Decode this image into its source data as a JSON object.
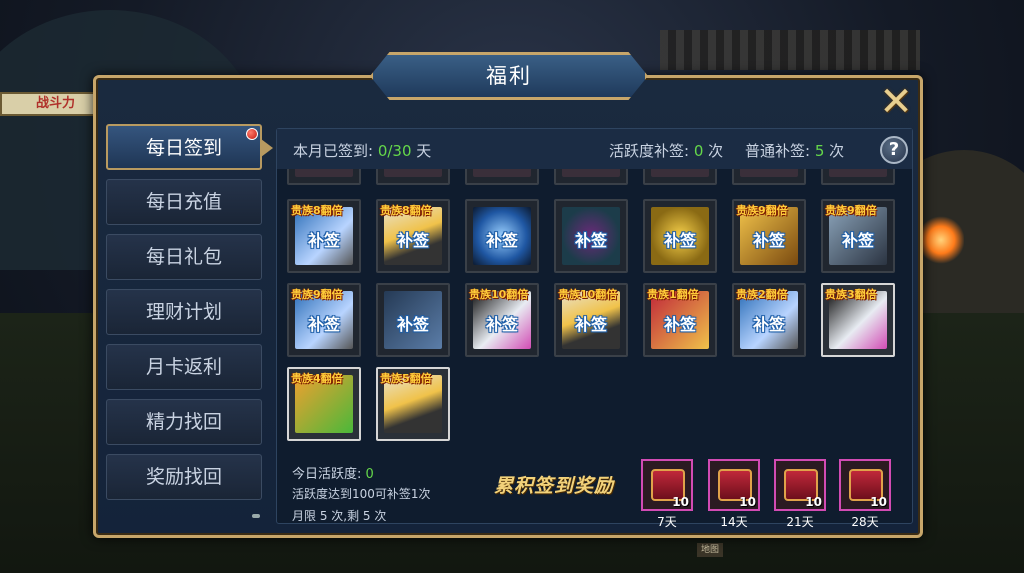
{
  "scene": {
    "sign_text": "战斗力",
    "bottom_label": "地图"
  },
  "window": {
    "title": "福利",
    "close_icon": "close-x-icon",
    "help_icon": "help-icon"
  },
  "sidebar": {
    "items": [
      {
        "label": "每日签到",
        "active": true,
        "badge": true
      },
      {
        "label": "每日充值"
      },
      {
        "label": "每日礼包"
      },
      {
        "label": "理财计划"
      },
      {
        "label": "月卡返利"
      },
      {
        "label": "精力找回"
      },
      {
        "label": "奖励找回"
      }
    ]
  },
  "info": {
    "signed_label": "本月已签到: ",
    "signed_value": "0/30",
    "signed_unit": " 天",
    "active_label": "活跃度补签: ",
    "active_value": "0",
    "active_unit": " 次",
    "normal_label": "普通补签: ",
    "normal_value": "5",
    "normal_unit": " 次"
  },
  "grid": {
    "makeup_label": "补签",
    "row_top_partial": 7,
    "tiles": [
      {
        "vip": "贵族8翻倍",
        "bq": true,
        "icon": "scroll-icon"
      },
      {
        "vip": "贵族8翻倍",
        "bq": true,
        "icon": "energy-plus10-icon"
      },
      {
        "vip": "",
        "bq": true,
        "icon": "planet-orb-icon"
      },
      {
        "vip": "",
        "bq": true,
        "icon": "demon-mask-icon"
      },
      {
        "vip": "",
        "bq": true,
        "icon": "gold-coins-icon"
      },
      {
        "vip": "贵族9翻倍",
        "bq": true,
        "icon": "gold-ingot-icon"
      },
      {
        "vip": "贵族9翻倍",
        "bq": true,
        "icon": "ore-stack-icon"
      },
      {
        "vip": "贵族9翻倍",
        "bq": true,
        "icon": "scroll-icon"
      },
      {
        "vip": "",
        "bq": true,
        "icon": "card-pack-icon"
      },
      {
        "vip": "贵族10翻倍",
        "bq": true,
        "icon": "blade-icon"
      },
      {
        "vip": "贵族10翻倍",
        "bq": true,
        "icon": "energy-plus10-icon"
      },
      {
        "vip": "贵族1翻倍",
        "bq": true,
        "icon": "red-book-icon"
      },
      {
        "vip": "贵族2翻倍",
        "bq": true,
        "icon": "scroll-icon"
      },
      {
        "vip": "贵族3翻倍",
        "bq": false,
        "icon": "blade-icon"
      },
      {
        "vip": "贵族4翻倍",
        "bq": false,
        "icon": "exp-potion-icon"
      },
      {
        "vip": "贵族5翻倍",
        "bq": false,
        "icon": "energy-plus10-icon"
      }
    ]
  },
  "bottom": {
    "today_label": "今日活跃度: ",
    "today_value": "0",
    "rule": "活跃度达到100可补签1次",
    "limit": "月限 5 次,剩 5 次",
    "reward_title": "累积签到奖励",
    "chests": [
      {
        "count": "10",
        "label": "7天"
      },
      {
        "count": "10",
        "label": "14天"
      },
      {
        "count": "10",
        "label": "21天"
      },
      {
        "count": "10",
        "label": "28天"
      }
    ]
  },
  "colors": {
    "accent_gold": "#c7a66a",
    "value_green": "#65d84a",
    "chest_border": "#d24bb4"
  }
}
